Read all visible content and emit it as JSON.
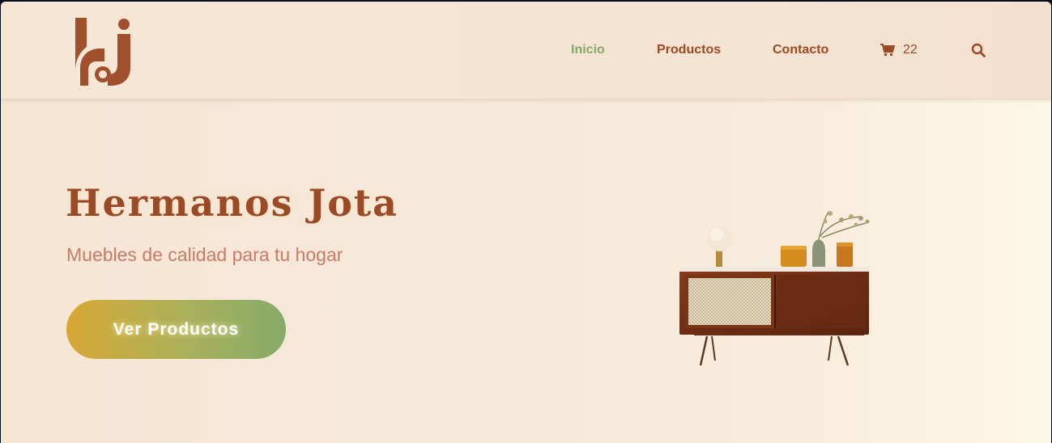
{
  "nav": {
    "links": [
      {
        "label": "Inicio",
        "active": true
      },
      {
        "label": "Productos",
        "active": false
      },
      {
        "label": "Contacto",
        "active": false
      }
    ],
    "cart": {
      "icon": "cart-icon",
      "count": "22"
    },
    "search": {
      "icon": "search-icon"
    }
  },
  "hero": {
    "title": "Hermanos Jota",
    "subtitle": "Muebles de calidad para tu hogar",
    "cta_label": "Ver Productos"
  },
  "colors": {
    "brand": "#9a4a25",
    "active_link": "#86a867",
    "subtitle": "#c77b6a",
    "button_gradient": [
      "#d8a836",
      "#86ab6a"
    ],
    "background": "#f5e6d6"
  }
}
